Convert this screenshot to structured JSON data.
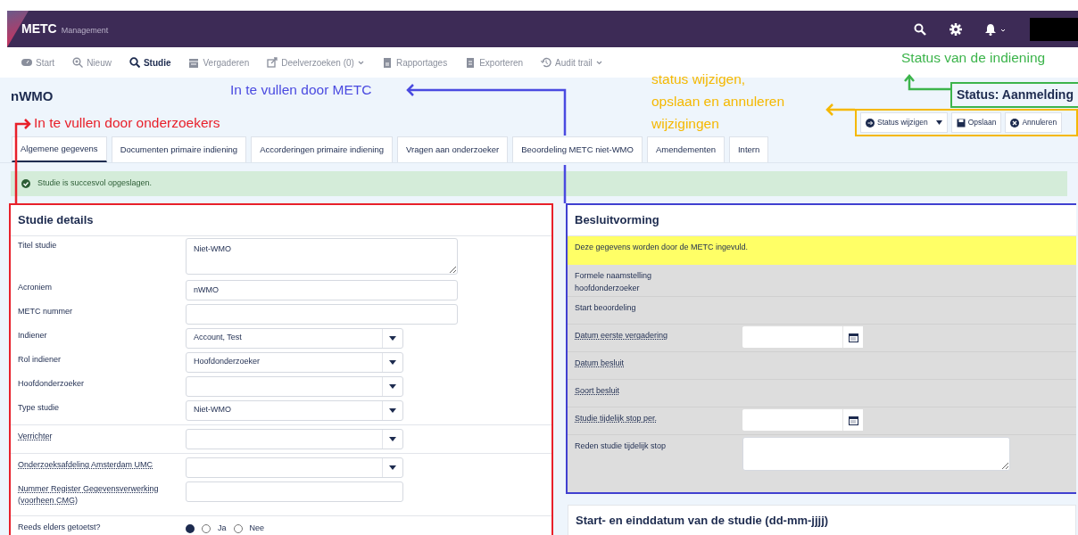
{
  "navbar": {
    "brand": "METC",
    "brand_sub": "Management"
  },
  "menu": [
    {
      "label": "Start",
      "selected": false,
      "dropdown": false
    },
    {
      "label": "Nieuw",
      "selected": false,
      "dropdown": false
    },
    {
      "label": "Studie",
      "selected": true,
      "dropdown": false
    },
    {
      "label": "Vergaderen",
      "selected": false,
      "dropdown": false
    },
    {
      "label": "Deelverzoeken (0)",
      "selected": false,
      "dropdown": true
    },
    {
      "label": "Rapportages",
      "selected": false,
      "dropdown": false
    },
    {
      "label": "Exporteren",
      "selected": false,
      "dropdown": false
    },
    {
      "label": "Audit trail",
      "selected": false,
      "dropdown": true
    }
  ],
  "page_title": "nWMO",
  "status": "Status: Aanmelding",
  "actions": [
    {
      "label": "Status wijzigen",
      "dropdown": true
    },
    {
      "label": "Opslaan",
      "dropdown": false
    },
    {
      "label": "Annuleren",
      "dropdown": false
    }
  ],
  "tabs": [
    {
      "label": "Algemene gegevens",
      "selected": true
    },
    {
      "label": "Documenten primaire indiening",
      "selected": false
    },
    {
      "label": "Accorderingen primaire indiening",
      "selected": false
    },
    {
      "label": "Vragen aan onderzoeker",
      "selected": false
    },
    {
      "label": "Beoordeling METC niet-WMO",
      "selected": false
    },
    {
      "label": "Amendementen",
      "selected": false
    },
    {
      "label": "Intern",
      "selected": false
    }
  ],
  "alert": "Studie is succesvol opgeslagen.",
  "left_panel": {
    "title": "Studie details",
    "groups": [
      {
        "fields": [
          {
            "label": "Titel studie",
            "kind": "textarea",
            "value": "Niet-WMO",
            "underlined": false
          },
          {
            "label": "Acroniem",
            "kind": "text",
            "value": "nWMO",
            "underlined": false
          },
          {
            "label": "METC nummer",
            "kind": "text",
            "underlined": false
          },
          {
            "label": "Indiener",
            "kind": "select",
            "value": "Account, Test",
            "underlined": false
          },
          {
            "label": "Rol indiener",
            "kind": "select",
            "value": "Hoofdonderzoeker",
            "underlined": false
          },
          {
            "label": "Hoofdonderzoeker",
            "kind": "select",
            "underlined": false
          },
          {
            "label": "Type studie",
            "kind": "select",
            "value": "Niet-WMO",
            "underlined": false
          }
        ]
      },
      {
        "fields": [
          {
            "label": "Verrichter",
            "kind": "select",
            "underlined": true
          }
        ]
      },
      {
        "fields": [
          {
            "label": "Onderzoeksafdeling Amsterdam UMC",
            "kind": "select",
            "underlined": true
          },
          {
            "label": "Nummer Register Gegevensverwerking (voorheen CMG)",
            "kind": "input-short",
            "underlined": true
          }
        ]
      },
      {
        "fields": [
          {
            "label": "Reeds elders getoetst?",
            "kind": "radio",
            "underlined": false,
            "options": [
              {
                "selected": true
              },
              {
                "label": "Ja",
                "selected": false
              },
              {
                "label": "Nee",
                "selected": false
              }
            ]
          }
        ]
      }
    ]
  },
  "right_panel": {
    "title": "Besluitvorming",
    "notice": "Deze gegevens worden door de METC ingevuld.",
    "fields": [
      {
        "label": "Formele naamstelling hoofdonderzoeker",
        "kind": "none",
        "underlined": false
      },
      {
        "label": "Start beoordeling",
        "kind": "none",
        "underlined": false
      },
      {
        "label": "Datum eerste vergadering",
        "kind": "date",
        "underlined": true
      },
      {
        "label": "Datum besluit",
        "kind": "none",
        "underlined": true
      },
      {
        "label": "Soort besluit",
        "kind": "none",
        "underlined": true
      },
      {
        "label": "Studie tijdelijk stop per.",
        "kind": "date",
        "underlined": true
      },
      {
        "label": "Reden studie tijdelijk stop",
        "kind": "textarea",
        "underlined": false
      }
    ]
  },
  "second_card": {
    "title": "Start- en einddatum van de studie (dd-mm-jjjj)"
  },
  "annotations": [
    {
      "text": "In te vullen door METC",
      "color": "#4a4ae0"
    },
    {
      "text": "In te vullen door onderzoekers",
      "color": "#e8202a"
    },
    {
      "text": "Status van de indiening",
      "color": "#3cb44b"
    },
    {
      "text": "status wijzigen, opslaan en annuleren wijzigingen",
      "color": "#f5b800"
    }
  ]
}
